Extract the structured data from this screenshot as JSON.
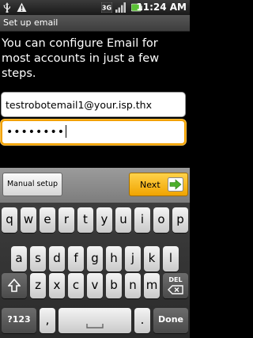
{
  "status_bar": {
    "time": "11:24 AM",
    "icons": [
      "usb-icon",
      "warning-icon",
      "3g-icon",
      "signal-icon",
      "battery-icon"
    ]
  },
  "title_bar": {
    "title": "Set up email"
  },
  "main": {
    "instruction": "You can configure Email for most accounts in just a few steps.",
    "email_value": "testrobotemail1@your.isp.thx",
    "password_value": "••••••••"
  },
  "buttons": {
    "manual_setup": "Manual setup",
    "next": "Next"
  },
  "keyboard": {
    "row1": [
      "q",
      "w",
      "e",
      "r",
      "t",
      "y",
      "u",
      "i",
      "o",
      "p"
    ],
    "row2": [
      "a",
      "s",
      "d",
      "f",
      "g",
      "h",
      "j",
      "k",
      "l"
    ],
    "row3": [
      "z",
      "x",
      "c",
      "v",
      "b",
      "n",
      "m"
    ],
    "del_label": "DEL",
    "symbols_label": "?123",
    "comma": ",",
    "period": ".",
    "done_label": "Done"
  },
  "colors": {
    "accent_orange": "#f2a100",
    "next_button": "#f7b21a",
    "next_arrow_green": "#4caf2a"
  }
}
